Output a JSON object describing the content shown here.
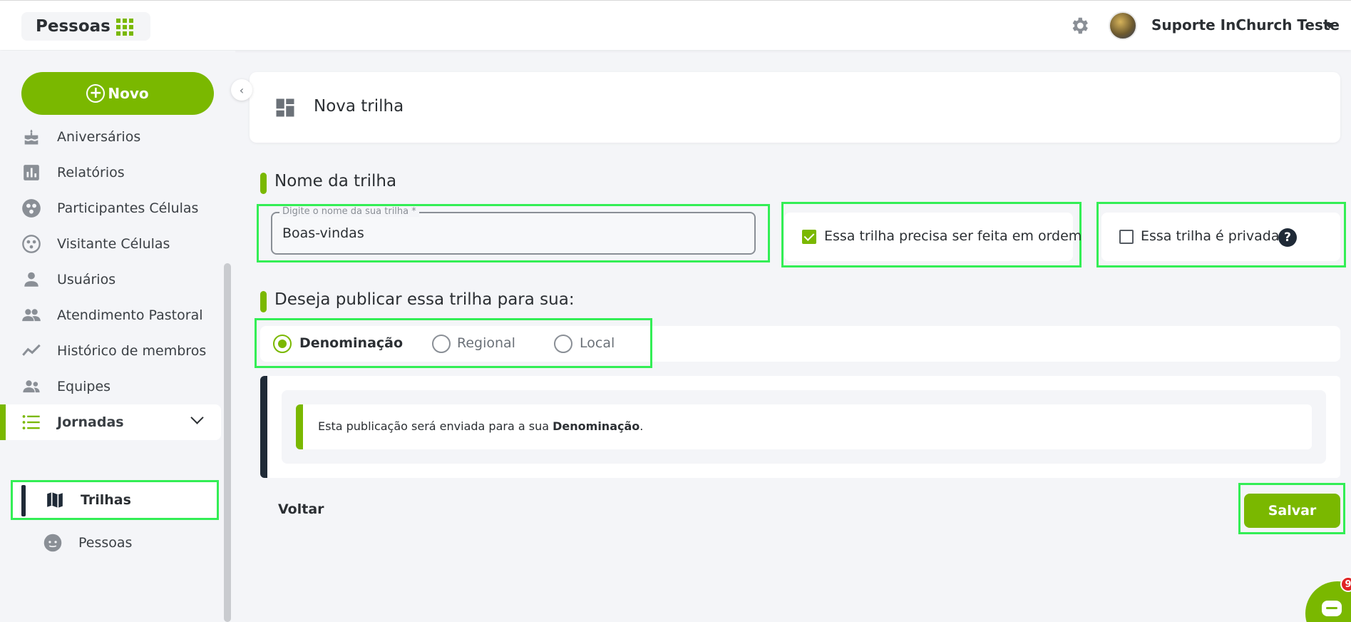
{
  "header": {
    "module_title": "Pessoas",
    "user_name": "Suporte InChurch Teste"
  },
  "sidebar": {
    "new_button_label": "Novo",
    "items": [
      {
        "label": "Aniversários",
        "icon": "cake-icon"
      },
      {
        "label": "Relatórios",
        "icon": "bar-chart-icon"
      },
      {
        "label": "Participantes Células",
        "icon": "cells-icon"
      },
      {
        "label": "Visitante Células",
        "icon": "cells-outline-icon"
      },
      {
        "label": "Usuários",
        "icon": "person-icon"
      },
      {
        "label": "Atendimento Pastoral",
        "icon": "people-icon"
      },
      {
        "label": "Histórico de membros",
        "icon": "trend-line-icon"
      },
      {
        "label": "Equipes",
        "icon": "team-icon"
      }
    ],
    "active_group": {
      "label": "Jornadas",
      "icon": "list-icon"
    },
    "sub_items": [
      {
        "label": "Trilhas",
        "icon": "map-icon"
      },
      {
        "label": "Pessoas",
        "icon": "face-icon"
      }
    ]
  },
  "main": {
    "page_title": "Nova trilha",
    "name_section_title": "Nome da trilha",
    "name_field": {
      "legend": "Digite o nome da sua trilha *",
      "value": "Boas-vindas"
    },
    "ordered_option": {
      "label": "Essa trilha precisa ser feita em ordem",
      "checked": true
    },
    "private_option": {
      "label": "Essa trilha é privada",
      "checked": false,
      "help_glyph": "?"
    },
    "publish_section_title": "Deseja publicar essa trilha para sua:",
    "publish_options": [
      {
        "label": "Denominação",
        "selected": true
      },
      {
        "label": "Regional",
        "selected": false
      },
      {
        "label": "Local",
        "selected": false
      }
    ],
    "info": {
      "prefix": "Esta publicação será enviada para a sua ",
      "target": "Denominação",
      "suffix": "."
    },
    "back_label": "Voltar",
    "save_label": "Salvar"
  },
  "chat": {
    "badge_count": "9"
  },
  "colors": {
    "accent": "#7ab800",
    "dark": "#1f2a37",
    "highlight": "#33ee55"
  }
}
